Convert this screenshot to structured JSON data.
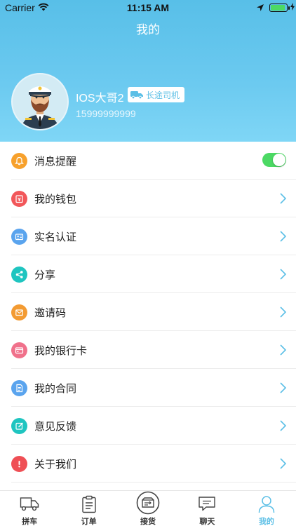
{
  "status_bar": {
    "carrier": "Carrier",
    "time": "11:15 AM"
  },
  "header": {
    "title": "我的"
  },
  "profile": {
    "name": "IOS大哥2",
    "role_badge": "长途司机",
    "phone": "15999999999"
  },
  "menu": {
    "items": [
      {
        "label": "消息提醒",
        "icon": "bell-icon",
        "color": "#f7a12c",
        "control": "toggle",
        "toggle_on": true
      },
      {
        "label": "我的钱包",
        "icon": "wallet-icon",
        "color": "#f2575a",
        "control": "chevron"
      },
      {
        "label": "实名认证",
        "icon": "id-card-icon",
        "color": "#5aa4ee",
        "control": "chevron"
      },
      {
        "label": "分享",
        "icon": "share-icon",
        "color": "#1fc5c0",
        "control": "chevron"
      },
      {
        "label": "邀请码",
        "icon": "envelope-icon",
        "color": "#f39b33",
        "control": "chevron"
      },
      {
        "label": "我的银行卡",
        "icon": "bank-card-icon",
        "color": "#f0718b",
        "control": "chevron"
      },
      {
        "label": "我的合同",
        "icon": "document-icon",
        "color": "#5aa4ee",
        "control": "chevron"
      },
      {
        "label": "意见反馈",
        "icon": "feedback-icon",
        "color": "#1fc5c0",
        "control": "chevron"
      },
      {
        "label": "关于我们",
        "icon": "alert-icon",
        "color": "#ef4f55",
        "control": "chevron"
      }
    ]
  },
  "tabbar": {
    "tabs": [
      {
        "label": "拼车",
        "icon": "truck-icon",
        "active": false
      },
      {
        "label": "订单",
        "icon": "clipboard-icon",
        "active": false
      },
      {
        "label": "接货",
        "icon": "box-icon",
        "active": false
      },
      {
        "label": "聊天",
        "icon": "chat-icon",
        "active": false
      },
      {
        "label": "我的",
        "icon": "person-icon",
        "active": true
      }
    ]
  },
  "colors": {
    "header_gradient_top": "#58bfe8",
    "header_gradient_bottom": "#7fd6f6",
    "accent": "#5bbfe6",
    "toggle_on": "#4cd964"
  }
}
